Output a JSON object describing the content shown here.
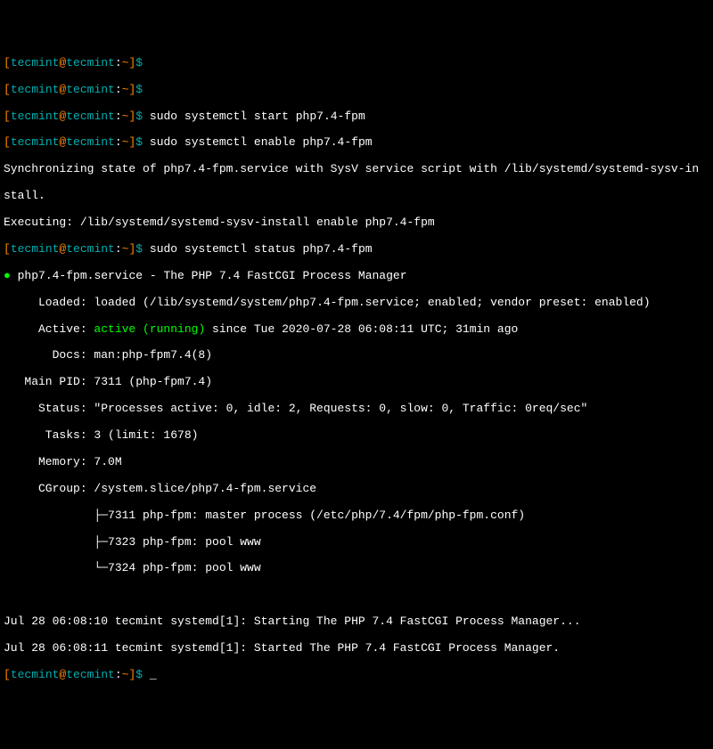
{
  "prompt": {
    "bracket_open": "[",
    "user": "tecmint",
    "at": "@",
    "host": "tecmint",
    "path_sep": ":",
    "path": "~",
    "bracket_close": "]",
    "dollar": "$",
    "space": " "
  },
  "commands": {
    "c1": "sudo systemctl start php7.4-fpm",
    "c2": "sudo systemctl enable php7.4-fpm",
    "c3": "sudo systemctl status php7.4-fpm"
  },
  "sync_output": {
    "l1": "Synchronizing state of php7.4-fpm.service with SysV service script with /lib/systemd/systemd-sysv-in",
    "l2": "stall.",
    "l3": "Executing: /lib/systemd/systemd-sysv-install enable php7.4-fpm"
  },
  "status": {
    "bullet": "●",
    "service_name": "php7.4-fpm.service - The PHP 7.4 FastCGI Process Manager",
    "loaded_label": "     Loaded: ",
    "loaded_value": "loaded (/lib/systemd/system/php7.4-fpm.service; enabled; vendor preset: enabled)",
    "active_label": "     Active: ",
    "active_state": "active (running)",
    "active_since": " since Tue 2020-07-28 06:08:11 UTC; 31min ago",
    "docs": "       Docs: man:php-fpm7.4(8)",
    "pid": "   Main PID: 7311 (php-fpm7.4)",
    "status_line": "     Status: \"Processes active: 0, idle: 2, Requests: 0, slow: 0, Traffic: 0req/sec\"",
    "tasks": "      Tasks: 3 (limit: 1678)",
    "memory": "     Memory: 7.0M",
    "cgroup": "     CGroup: /system.slice/php7.4-fpm.service",
    "proc1": "             ├─7311 php-fpm: master process (/etc/php/7.4/fpm/php-fpm.conf)",
    "proc2": "             ├─7323 php-fpm: pool www",
    "proc3": "             └─7324 php-fpm: pool www"
  },
  "log": {
    "l1": "Jul 28 06:08:10 tecmint systemd[1]: Starting The PHP 7.4 FastCGI Process Manager...",
    "l2": "Jul 28 06:08:11 tecmint systemd[1]: Started The PHP 7.4 FastCGI Process Manager."
  },
  "cursor": " _"
}
